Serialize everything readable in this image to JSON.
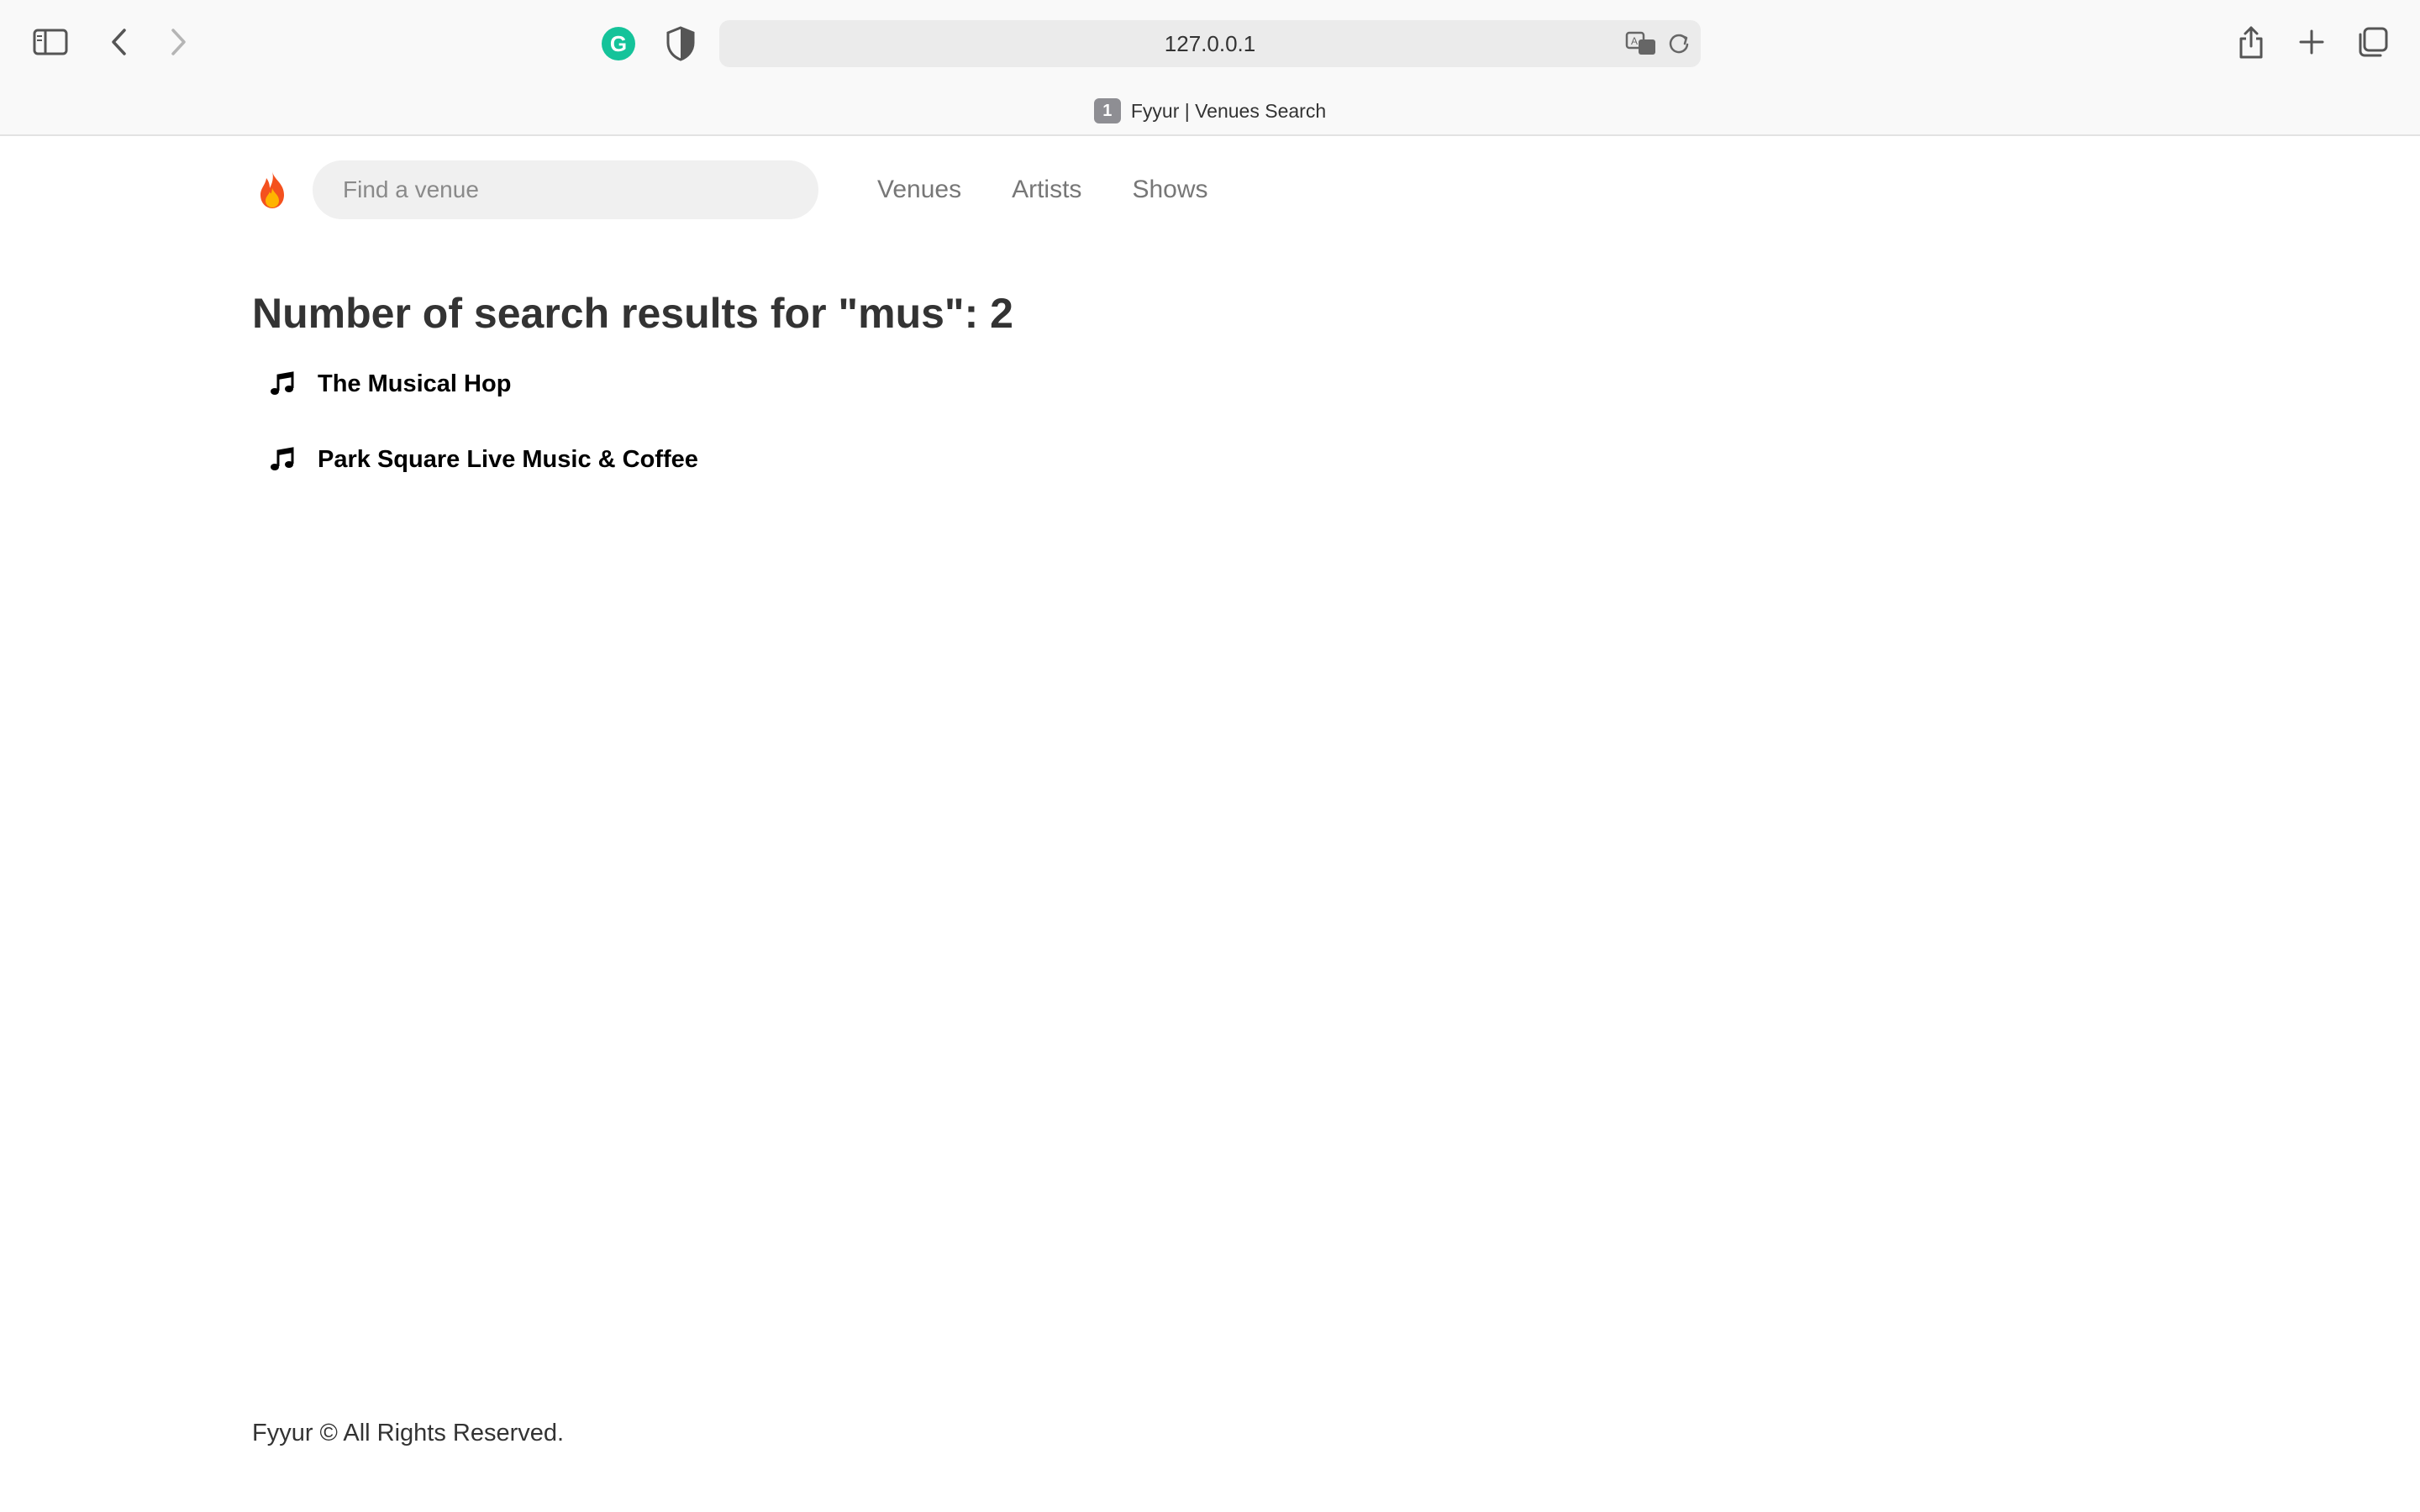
{
  "browser": {
    "url": "127.0.0.1",
    "tab_number": "1",
    "tab_title": "Fyyur | Venues Search",
    "icons": [
      "sidebar-icon",
      "back-icon",
      "forward-icon",
      "grammarly-icon",
      "shield-icon",
      "translate-icon",
      "reload-icon",
      "share-icon",
      "new-tab-icon",
      "tab-overview-icon"
    ],
    "grammarly_letter": "G"
  },
  "navbar": {
    "brand_icon": "fire-icon",
    "search_placeholder": "Find a venue",
    "search_value": "",
    "links": [
      {
        "label": "Venues"
      },
      {
        "label": "Artists"
      },
      {
        "label": "Shows"
      }
    ]
  },
  "main": {
    "heading": "Number of search results for \"mus\": 2",
    "results": [
      {
        "icon": "music-note-icon",
        "name": "The Musical Hop"
      },
      {
        "icon": "music-note-icon",
        "name": "Park Square Live Music & Coffee"
      }
    ]
  },
  "footer": {
    "text": "Fyyur © All Rights Reserved."
  },
  "colors": {
    "accent_green": "#15c39a",
    "fire_orange": "#f4511e"
  }
}
